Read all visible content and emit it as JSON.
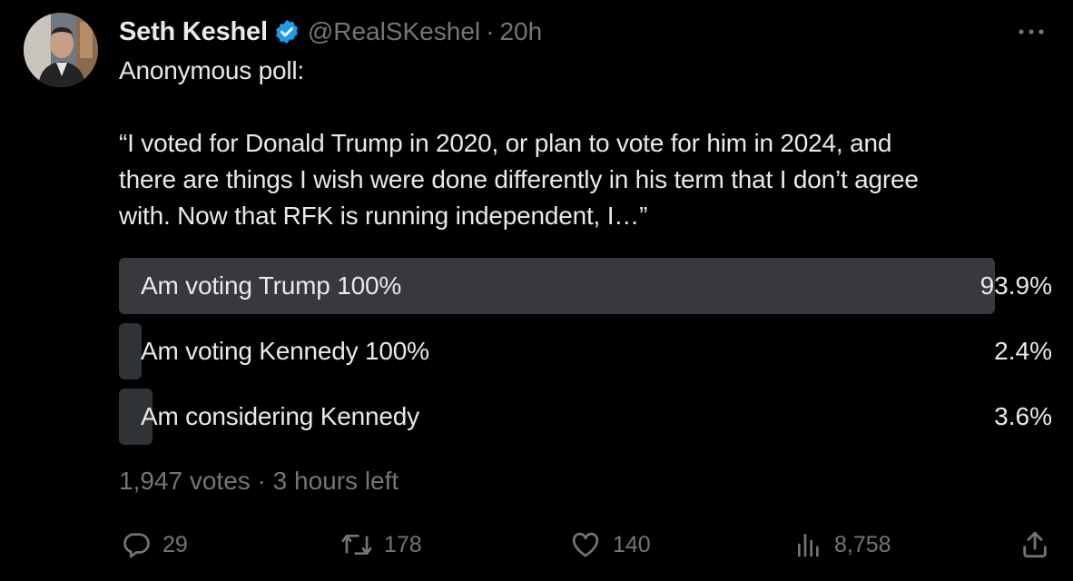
{
  "author": {
    "name": "Seth Keshel",
    "handle": "@RealSKeshel",
    "separator": "·",
    "time": "20h"
  },
  "tweet": {
    "lines": [
      "Anonymous poll:",
      "“I voted for Donald Trump in 2020, or plan to vote for him in 2024, and",
      "there are things I wish were done differently in his term that I don’t agree",
      "with. Now that RFK is running independent, I…”"
    ]
  },
  "poll": {
    "options": [
      {
        "label": "Am voting Trump 100%",
        "percent": "93.9%",
        "fraction": 0.939,
        "winner": true
      },
      {
        "label": "Am voting Kennedy 100%",
        "percent": "2.4%",
        "fraction": 0.024,
        "winner": false
      },
      {
        "label": "Am considering Kennedy",
        "percent": "3.6%",
        "fraction": 0.036,
        "winner": false
      }
    ],
    "meta": "1,947 votes · 3 hours left"
  },
  "actions": {
    "replies": "29",
    "reposts": "178",
    "likes": "140",
    "views": "8,758"
  },
  "colors": {
    "background": "#000000",
    "text": "#e7e9ea",
    "muted": "#71767b",
    "verified": "#1d9bf0",
    "poll_winner": "#37393d",
    "poll_other": "#2f3336"
  },
  "icons": {
    "verified": "verified-badge-icon",
    "more": "more-icon",
    "reply": "reply-icon",
    "repost": "repost-icon",
    "like": "like-icon",
    "views": "views-icon",
    "share": "share-icon"
  }
}
